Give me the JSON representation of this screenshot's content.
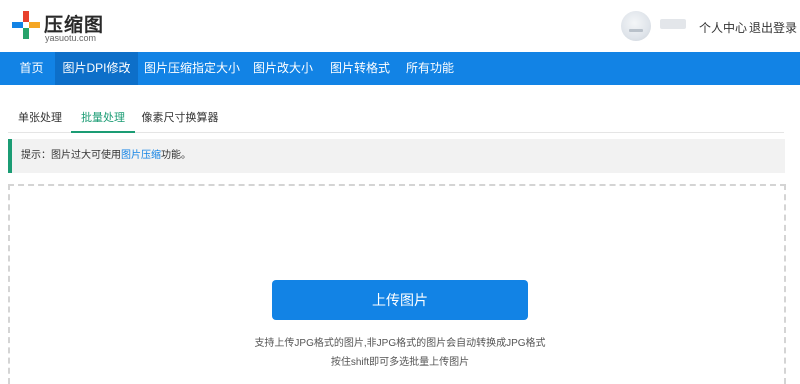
{
  "header": {
    "logo_name": "压缩图",
    "logo_sub": "yasuotu.com",
    "personal_center": "个人中心",
    "logout": "退出登录"
  },
  "nav": {
    "items": [
      {
        "label": "首页"
      },
      {
        "label": "图片DPI修改",
        "active": true
      },
      {
        "label": "图片压缩指定大小"
      },
      {
        "label": "图片改大小"
      },
      {
        "label": "图片转格式"
      },
      {
        "label": "所有功能"
      }
    ]
  },
  "tabs": {
    "items": [
      {
        "label": "单张处理"
      },
      {
        "label": "批量处理",
        "active": true
      },
      {
        "label": "像素尺寸换算器"
      }
    ]
  },
  "tip": {
    "prefix": "提示：图片过大可使用",
    "link": "图片压缩",
    "suffix": "功能。"
  },
  "upload": {
    "button": "上传图片",
    "hint_formats": "支持上传JPG格式的图片,非JPG格式的图片会自动转换成JPG格式",
    "hint_batch": "按住shift即可多选批量上传图片"
  },
  "colors": {
    "accent_blue": "#1283e5",
    "nav_active": "#0d6fc9",
    "tab_green": "#1b9c74"
  }
}
